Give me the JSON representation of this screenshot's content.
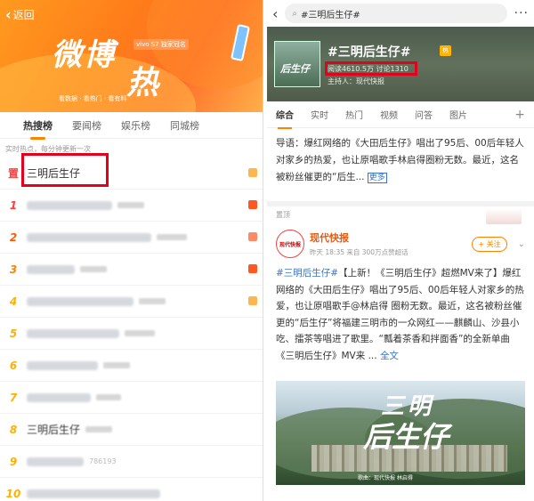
{
  "left": {
    "back_label": "返回",
    "logo_line1": "微博",
    "logo_line2": "热搜",
    "sponsor": "vivo S7 独家冠名",
    "slogan": "看数据 · 看热门 · 看有料",
    "tabs": [
      {
        "label": "热搜榜"
      },
      {
        "label": "要闻榜"
      },
      {
        "label": "娱乐榜"
      },
      {
        "label": "同城榜"
      }
    ],
    "subhint": "实时热点，每分钟更新一次",
    "top_rank": "置",
    "first_title": "三明后生仔",
    "list_ranks": [
      "1",
      "2",
      "3",
      "4",
      "5",
      "6",
      "7",
      "8",
      "9",
      "10"
    ],
    "row8_title": "三明后生仔",
    "row9_num": "786193"
  },
  "right": {
    "search_text": "#三明后生仔#",
    "topic": "#三明后生仔#",
    "badge": "热",
    "thumb_text": "后生仔",
    "stats": "阅读4610.5万  讨论1310",
    "host": "主持人：现代快报",
    "tabs": [
      {
        "label": "综合"
      },
      {
        "label": "实时"
      },
      {
        "label": "热门"
      },
      {
        "label": "视频"
      },
      {
        "label": "问答"
      },
      {
        "label": "图片"
      }
    ],
    "plus": "+",
    "guide_text": "导语：爆红网络的《大田后生仔》唱出了95后、00后年轻人对家乡的热爱，也让原唱歌手林启得圈粉无数。最近，这名被粉丝催更的“后生...",
    "more": "更多",
    "hot_label": "置顶",
    "post_author": "现代快报",
    "post_meta": "昨天 18:35  来自 300万点赞超话",
    "follow": "+ 关注",
    "avatar_text": "现代快报",
    "post_topic": "#三明后生仔#",
    "post_text": "【上新！《三明后生仔》超燃MV来了】爆红网络的《大田后生仔》唱出了95后、00后年轻人对家乡的热爱，也让原唱歌手@林启得 圈粉无数。最近，这名被粉丝催更的“后生仔”将福建三明市的一众网红——麒麟山、沙县小吃、擂茶等唱进了歌里。“瓢着茶香和拌面香”的全新单曲《三明后生仔》MV来 ...",
    "full_text": "全文",
    "photo_title1": "三明",
    "photo_title2": "后生仔",
    "photo_caption": "歌曲：现代快报    林启得"
  }
}
